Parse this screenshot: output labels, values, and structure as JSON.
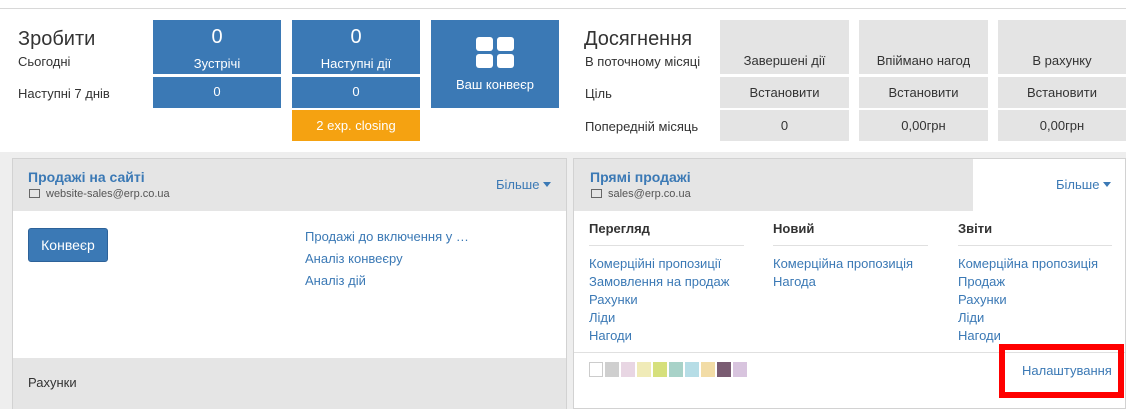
{
  "todo": {
    "title": "Зробити",
    "today": "Сьогодні",
    "next7": "Наступні 7 днів",
    "meetings": {
      "today": "0",
      "label": "Зустрічі",
      "next7": "0"
    },
    "next_actions": {
      "today": "0",
      "label": "Наступні дії",
      "next7": "0"
    },
    "exp_closing": "2 exp. closing",
    "pipeline_label": "Ваш конвеєр"
  },
  "achievements": {
    "title": "Досягнення",
    "this_month": "В поточному місяці",
    "target": "Ціль",
    "prev_month": "Попередній місяць",
    "columns": [
      {
        "header": "Завершені дії",
        "target": "Встановити",
        "prev": "0"
      },
      {
        "header": "Впіймано нагод",
        "target": "Встановити",
        "prev": "0,00грн"
      },
      {
        "header": "В рахунку",
        "target": "Встановити",
        "prev": "0,00грн"
      }
    ]
  },
  "panel_left": {
    "title": "Продажі на сайті",
    "email": "website-sales@erp.co.ua",
    "more": "Більше",
    "button": "Конвеєр",
    "links": [
      "Продажі до включення у …",
      "Аналіз конвеєру",
      "Аналіз дій"
    ],
    "footer": "Рахунки"
  },
  "panel_right": {
    "title": "Прямі продажі",
    "email": "sales@erp.co.ua",
    "more": "Більше",
    "columns": [
      {
        "header": "Перегляд",
        "links": [
          "Комерційні пропозиції",
          "Замовлення на продаж",
          "Рахунки",
          "Ліди",
          "Нагоди"
        ]
      },
      {
        "header": "Новий",
        "links": [
          "Комерційна пропозиція",
          "Нагода"
        ]
      },
      {
        "header": "Звіти",
        "links": [
          "Комерційна пропозиція",
          "Продаж",
          "Рахунки",
          "Ліди",
          "Нагоди"
        ]
      }
    ],
    "settings": "Налаштування",
    "swatch_colors": [
      "#ffffff",
      "#cfcfcf",
      "#e8d6e3",
      "#f0ebb8",
      "#d6e07c",
      "#a8d2c8",
      "#b6dde6",
      "#f2dca6",
      "#7a5c72",
      "#d8c4de"
    ]
  },
  "colors": {
    "accent": "#3b79b5",
    "warning": "#f5a211",
    "highlight": "#ff0000"
  }
}
